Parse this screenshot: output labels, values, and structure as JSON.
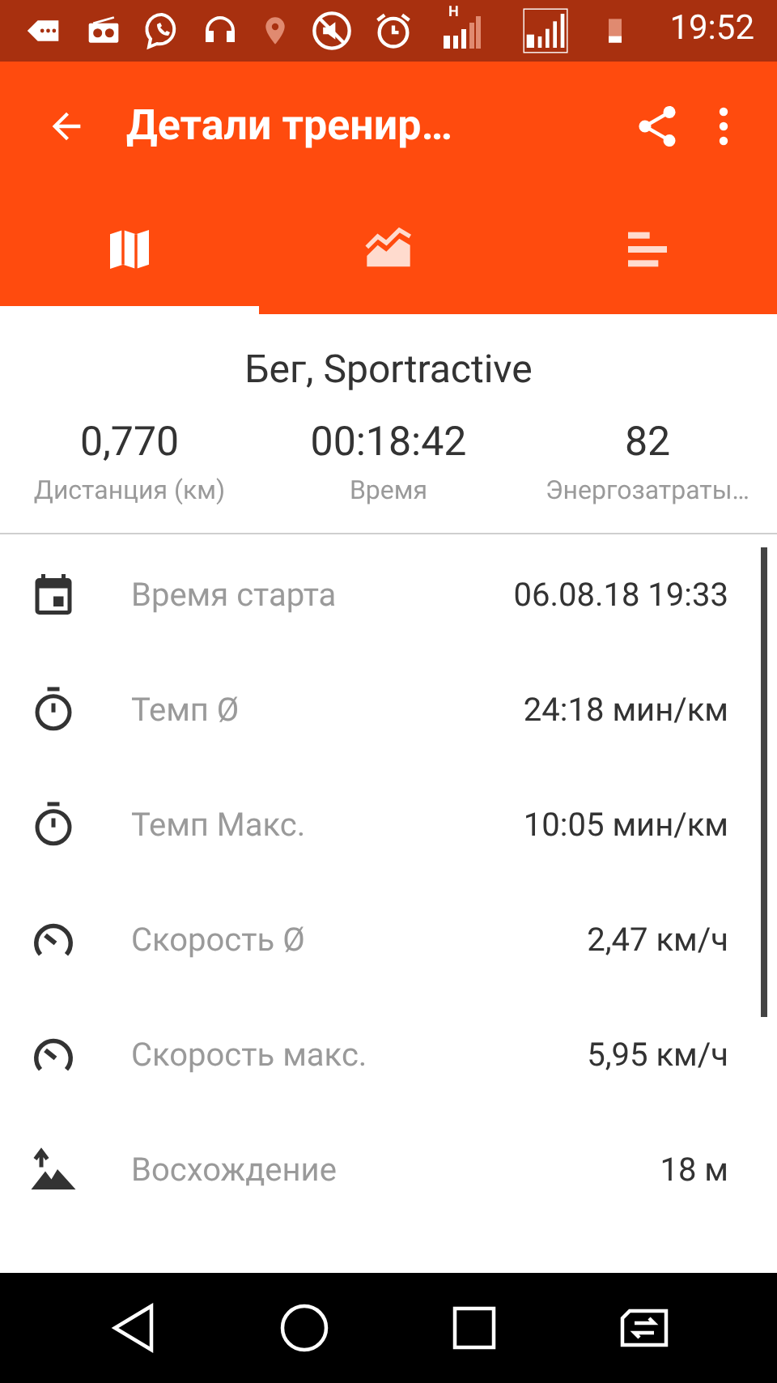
{
  "status_bar": {
    "time": "19:52",
    "sim1_network": "H"
  },
  "app_bar": {
    "title": "Детали тренир…"
  },
  "tabs": [
    {
      "kind": "map",
      "selected": true
    },
    {
      "kind": "chart",
      "selected": false
    },
    {
      "kind": "bars",
      "selected": false
    }
  ],
  "summary": {
    "title": "Бег, Sportractive",
    "stats": [
      {
        "value": "0,770",
        "label": "Дистанция (км)"
      },
      {
        "value": "00:18:42",
        "label": "Время"
      },
      {
        "value": "82",
        "label": "Энергозатраты…"
      }
    ]
  },
  "details": [
    {
      "kind": "calendar",
      "label": "Время старта",
      "value": "06.08.18 19:33"
    },
    {
      "kind": "stopwatch",
      "label": "Темп Ø",
      "value": "24:18 мин/км"
    },
    {
      "kind": "stopwatch",
      "label": "Темп Макс.",
      "value": "10:05 мин/км"
    },
    {
      "kind": "speed",
      "label": "Скорость Ø",
      "value": "2,47 км/ч"
    },
    {
      "kind": "speed",
      "label": "Скорость макс.",
      "value": "5,95 км/ч"
    },
    {
      "kind": "ascent",
      "label": "Восхождение",
      "value": "18 м"
    }
  ]
}
